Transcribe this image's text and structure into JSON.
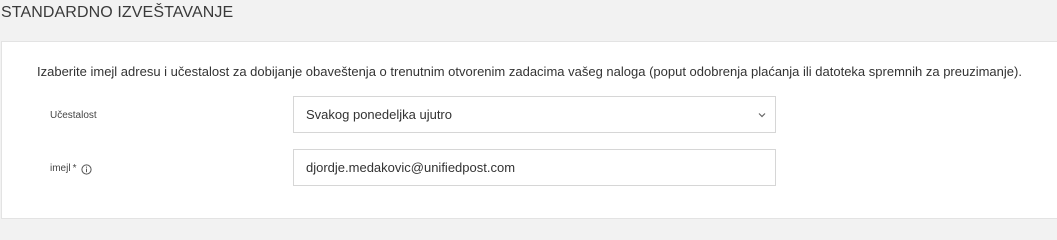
{
  "section": {
    "title": "STANDARDNO IZVEŠTAVANJE"
  },
  "form": {
    "description": "Izaberite imejl adresu i učestalost za dobijanje obaveštenja o trenutnim otvorenim zadacima vašeg naloga (poput odobrenja plaćanja ili datoteka spremnih za preuzimanje).",
    "frequency": {
      "label": "Učestalost",
      "selected_value": "Svakog ponedeljka ujutro",
      "icon": "chevron-down-icon"
    },
    "email": {
      "label": "imejl",
      "required_marker": "*",
      "info_icon": "info-icon",
      "value": "djordje.medakovic@unifiedpost.com"
    }
  },
  "colors": {
    "page_background": "#f2f2f2",
    "card_background": "#ffffff",
    "border": "#d6d6d6",
    "text": "#333333"
  }
}
